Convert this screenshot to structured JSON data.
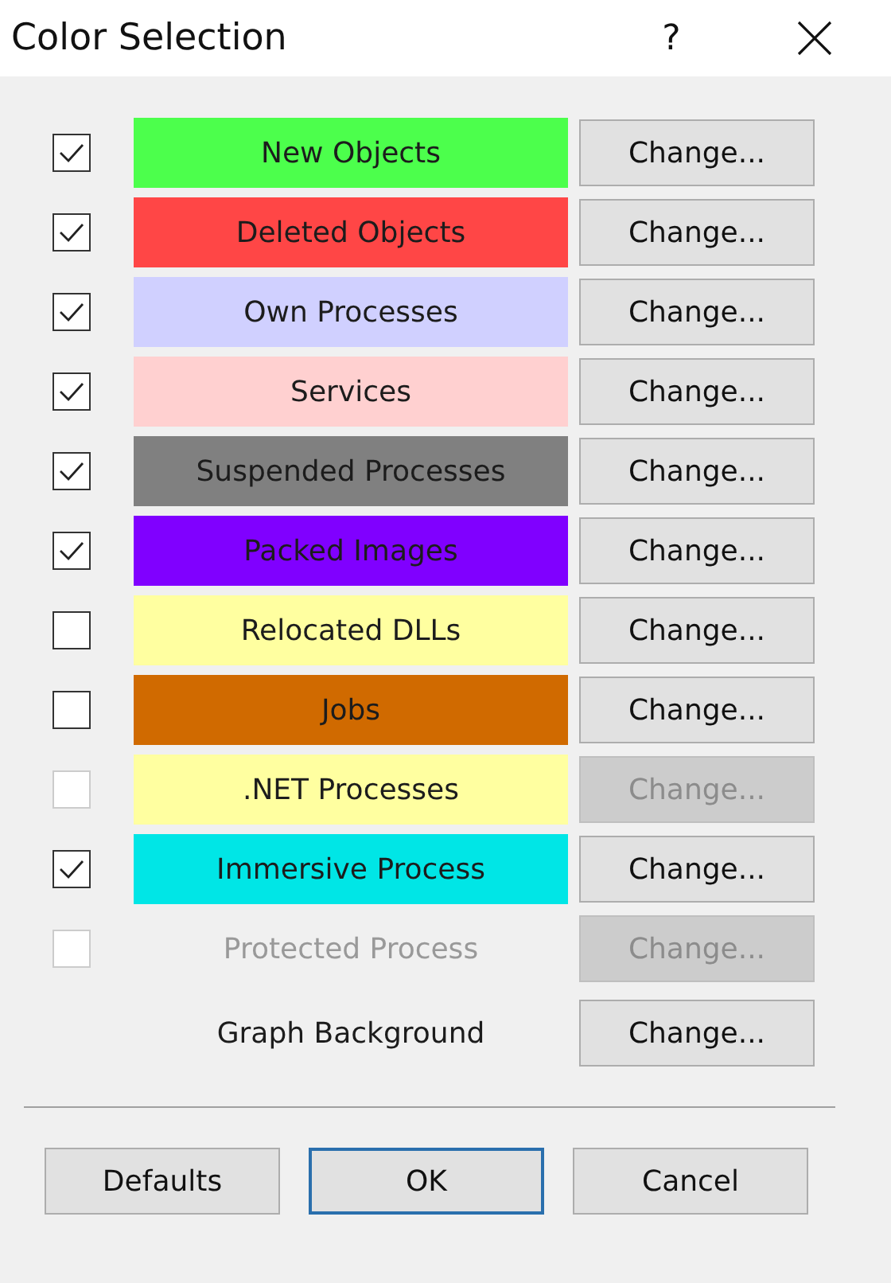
{
  "window": {
    "title": "Color Selection",
    "help": "?"
  },
  "rows": [
    {
      "kind": "option",
      "label": "New Objects",
      "color": "#4cff4c",
      "checked": true,
      "disabled": false,
      "button": "Change..."
    },
    {
      "kind": "option",
      "label": "Deleted Objects",
      "color": "#ff4646",
      "checked": true,
      "disabled": false,
      "button": "Change..."
    },
    {
      "kind": "option",
      "label": "Own Processes",
      "color": "#d0d0ff",
      "checked": true,
      "disabled": false,
      "button": "Change..."
    },
    {
      "kind": "option",
      "label": "Services",
      "color": "#ffd0d0",
      "checked": true,
      "disabled": false,
      "button": "Change..."
    },
    {
      "kind": "option",
      "label": "Suspended Processes",
      "color": "#808080",
      "checked": true,
      "disabled": false,
      "button": "Change..."
    },
    {
      "kind": "option",
      "label": "Packed Images",
      "color": "#8000ff",
      "checked": true,
      "disabled": false,
      "button": "Change..."
    },
    {
      "kind": "option",
      "label": "Relocated DLLs",
      "color": "#ffffa0",
      "checked": false,
      "disabled": false,
      "button": "Change..."
    },
    {
      "kind": "option",
      "label": "Jobs",
      "color": "#d06a00",
      "checked": false,
      "disabled": false,
      "button": "Change..."
    },
    {
      "kind": "option",
      "label": ".NET Processes",
      "color": "#ffffa0",
      "checked": false,
      "disabled": true,
      "button": "Change..."
    },
    {
      "kind": "option",
      "label": "Immersive Process",
      "color": "#00e6e6",
      "checked": true,
      "disabled": false,
      "button": "Change..."
    },
    {
      "kind": "option",
      "label": "Protected Process",
      "checked": false,
      "disabled": true,
      "button": "Change..."
    },
    {
      "kind": "plain",
      "label": "Graph Background",
      "button": "Change..."
    }
  ],
  "buttons": [
    {
      "label": "Defaults",
      "selected": false
    },
    {
      "label": "OK",
      "selected": true
    },
    {
      "label": "Cancel",
      "selected": false
    }
  ]
}
